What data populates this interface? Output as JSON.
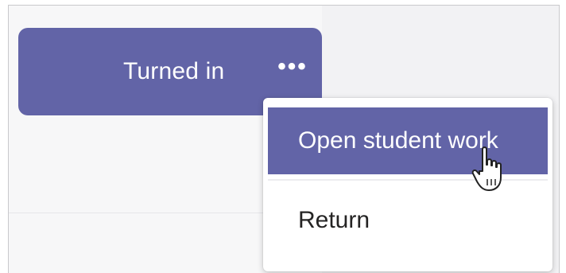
{
  "card": {
    "status_label": "Turned in",
    "more_label": "•••"
  },
  "menu": {
    "items": [
      {
        "label": "Open student work",
        "highlighted": true
      },
      {
        "label": "Return",
        "highlighted": false
      }
    ]
  },
  "colors": {
    "accent": "#6264a7",
    "menu_text": "#252424",
    "background": "#f2f2f4"
  },
  "icons": {
    "cursor": "hand-pointer-icon",
    "more": "more-options-icon"
  }
}
